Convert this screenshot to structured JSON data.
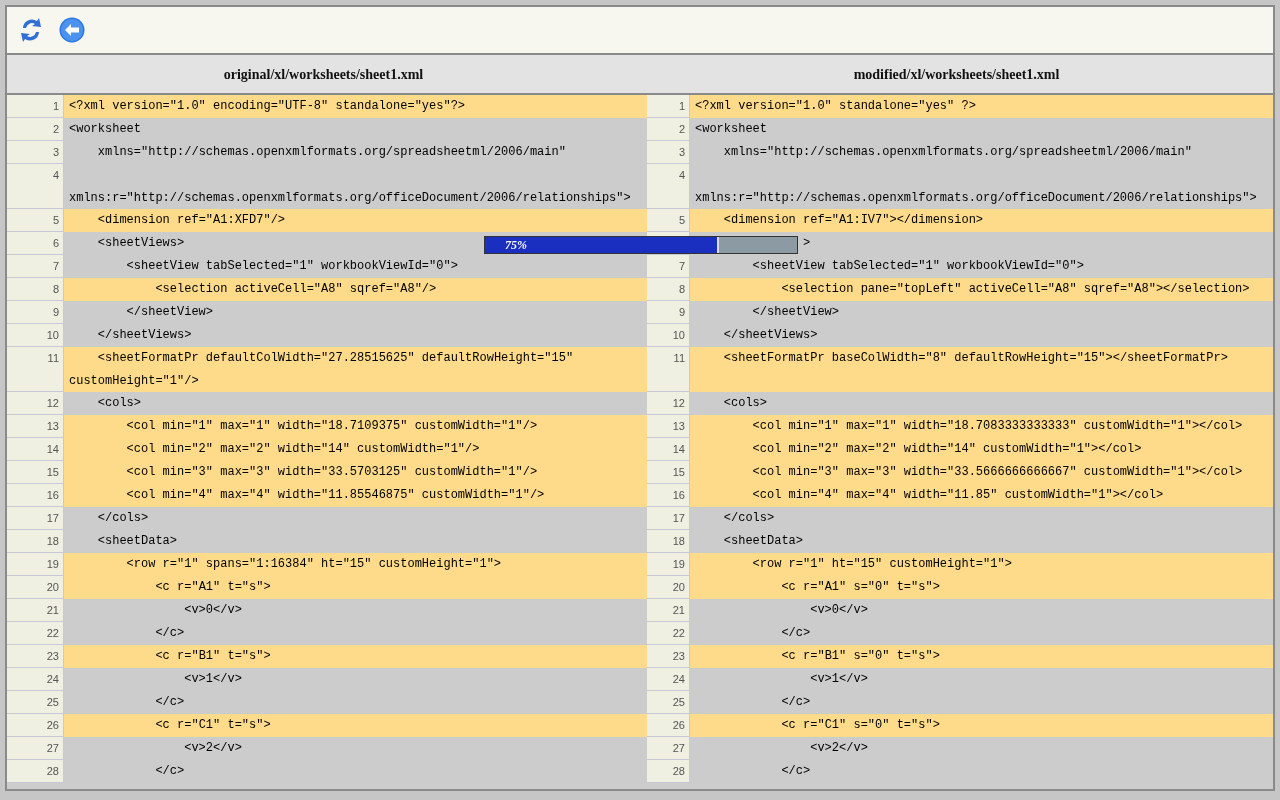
{
  "toolbar": {
    "buttons": [
      {
        "kind": "refresh"
      },
      {
        "kind": "back"
      }
    ]
  },
  "headers": [
    "original/xl/worksheets/sheet1.xml",
    "modified/xl/worksheets/sheet1.xml"
  ],
  "rows": [
    {
      "changed": true,
      "left": {
        "number": "1",
        "text": "<?xml version=\"1.0\" encoding=\"UTF-8\" standalone=\"yes\"?>"
      },
      "right": {
        "number": "1",
        "text": "<?xml version=\"1.0\" standalone=\"yes\" ?>"
      }
    },
    {
      "changed": false,
      "left": {
        "number": "2",
        "text": "<worksheet"
      },
      "right": {
        "number": "2",
        "text": "<worksheet"
      }
    },
    {
      "changed": false,
      "left": {
        "number": "3",
        "text": "    xmlns=\"http://schemas.openxmlformats.org/spreadsheetml/2006/main\""
      },
      "right": {
        "number": "3",
        "text": "    xmlns=\"http://schemas.openxmlformats.org/spreadsheetml/2006/main\""
      }
    },
    {
      "changed": false,
      "left": {
        "number": "4",
        "text": "    xmlns:r=\"http://schemas.openxmlformats.org/officeDocument/2006/relationships\">"
      },
      "right": {
        "number": "4",
        "text": "    xmlns:r=\"http://schemas.openxmlformats.org/officeDocument/2006/relationships\">"
      }
    },
    {
      "changed": true,
      "left": {
        "number": "5",
        "text": "    <dimension ref=\"A1:XFD7\"/>"
      },
      "right": {
        "number": "5",
        "text": "    <dimension ref=\"A1:IV7\"></dimension>"
      }
    },
    {
      "changed": false,
      "left": {
        "number": "6",
        "text": "    <sheetViews>"
      },
      "right": {
        "text": "               >"
      }
    },
    {
      "changed": false,
      "left": {
        "number": "7",
        "text": "        <sheetView tabSelected=\"1\" workbookViewId=\"0\">"
      },
      "right": {
        "number": "7",
        "text": "        <sheetView tabSelected=\"1\" workbookViewId=\"0\">"
      }
    },
    {
      "changed": true,
      "left": {
        "number": "8",
        "text": "            <selection activeCell=\"A8\" sqref=\"A8\"/>"
      },
      "right": {
        "number": "8",
        "text": "            <selection pane=\"topLeft\" activeCell=\"A8\" sqref=\"A8\"></selection>"
      }
    },
    {
      "changed": false,
      "left": {
        "number": "9",
        "text": "        </sheetView>"
      },
      "right": {
        "number": "9",
        "text": "        </sheetView>"
      }
    },
    {
      "changed": false,
      "left": {
        "number": "10",
        "text": "    </sheetViews>"
      },
      "right": {
        "number": "10",
        "text": "    </sheetViews>"
      }
    },
    {
      "changed": true,
      "left": {
        "number": "11",
        "text": "    <sheetFormatPr defaultColWidth=\"27.28515625\" defaultRowHeight=\"15\" customHeight=\"1\"/>"
      },
      "right": {
        "number": "11",
        "text": "    <sheetFormatPr baseColWidth=\"8\" defaultRowHeight=\"15\"></sheetFormatPr>"
      }
    },
    {
      "changed": false,
      "left": {
        "number": "12",
        "text": "    <cols>"
      },
      "right": {
        "number": "12",
        "text": "    <cols>"
      }
    },
    {
      "changed": true,
      "left": {
        "number": "13",
        "text": "        <col min=\"1\" max=\"1\" width=\"18.7109375\" customWidth=\"1\"/>"
      },
      "right": {
        "number": "13",
        "text": "        <col min=\"1\" max=\"1\" width=\"18.7083333333333\" customWidth=\"1\"></col>"
      }
    },
    {
      "changed": true,
      "left": {
        "number": "14",
        "text": "        <col min=\"2\" max=\"2\" width=\"14\" customWidth=\"1\"/>"
      },
      "right": {
        "number": "14",
        "text": "        <col min=\"2\" max=\"2\" width=\"14\" customWidth=\"1\"></col>"
      }
    },
    {
      "changed": true,
      "left": {
        "number": "15",
        "text": "        <col min=\"3\" max=\"3\" width=\"33.5703125\" customWidth=\"1\"/>"
      },
      "right": {
        "number": "15",
        "text": "        <col min=\"3\" max=\"3\" width=\"33.5666666666667\" customWidth=\"1\"></col>"
      }
    },
    {
      "changed": true,
      "left": {
        "number": "16",
        "text": "        <col min=\"4\" max=\"4\" width=\"11.85546875\" customWidth=\"1\"/>"
      },
      "right": {
        "number": "16",
        "text": "        <col min=\"4\" max=\"4\" width=\"11.85\" customWidth=\"1\"></col>"
      }
    },
    {
      "changed": false,
      "left": {
        "number": "17",
        "text": "    </cols>"
      },
      "right": {
        "number": "17",
        "text": "    </cols>"
      }
    },
    {
      "changed": false,
      "left": {
        "number": "18",
        "text": "    <sheetData>"
      },
      "right": {
        "number": "18",
        "text": "    <sheetData>"
      }
    },
    {
      "changed": true,
      "left": {
        "number": "19",
        "text": "        <row r=\"1\" spans=\"1:16384\" ht=\"15\" customHeight=\"1\">"
      },
      "right": {
        "number": "19",
        "text": "        <row r=\"1\" ht=\"15\" customHeight=\"1\">"
      }
    },
    {
      "changed": true,
      "left": {
        "number": "20",
        "text": "            <c r=\"A1\" t=\"s\">"
      },
      "right": {
        "number": "20",
        "text": "            <c r=\"A1\" s=\"0\" t=\"s\">"
      }
    },
    {
      "changed": false,
      "left": {
        "number": "21",
        "text": "                <v>0</v>"
      },
      "right": {
        "number": "21",
        "text": "                <v>0</v>"
      }
    },
    {
      "changed": false,
      "left": {
        "number": "22",
        "text": "            </c>"
      },
      "right": {
        "number": "22",
        "text": "            </c>"
      }
    },
    {
      "changed": true,
      "left": {
        "number": "23",
        "text": "            <c r=\"B1\" t=\"s\">"
      },
      "right": {
        "number": "23",
        "text": "            <c r=\"B1\" s=\"0\" t=\"s\">"
      }
    },
    {
      "changed": false,
      "left": {
        "number": "24",
        "text": "                <v>1</v>"
      },
      "right": {
        "number": "24",
        "text": "                <v>1</v>"
      }
    },
    {
      "changed": false,
      "left": {
        "number": "25",
        "text": "            </c>"
      },
      "right": {
        "number": "25",
        "text": "            </c>"
      }
    },
    {
      "changed": true,
      "left": {
        "number": "26",
        "text": "            <c r=\"C1\" t=\"s\">"
      },
      "right": {
        "number": "26",
        "text": "            <c r=\"C1\" s=\"0\" t=\"s\">"
      }
    },
    {
      "changed": false,
      "left": {
        "number": "27",
        "text": "                <v>2</v>"
      },
      "right": {
        "number": "27",
        "text": "                <v>2</v>"
      }
    },
    {
      "changed": false,
      "left": {
        "number": "28",
        "text": "            </c>"
      },
      "right": {
        "number": "28",
        "text": "            </c>"
      }
    }
  ],
  "progress": {
    "label": "75%",
    "level": 0.75
  }
}
